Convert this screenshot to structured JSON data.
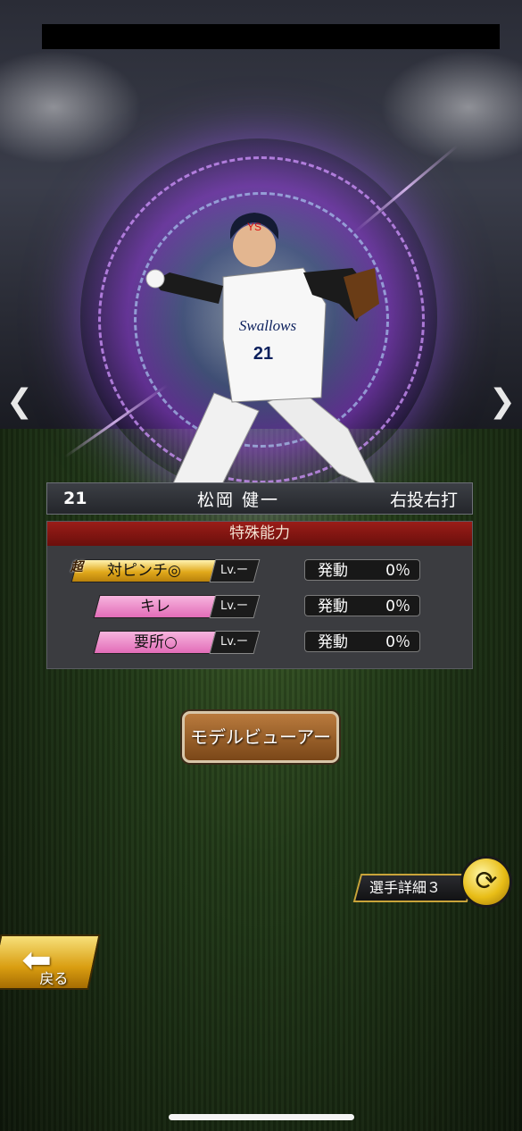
{
  "player": {
    "number": "21",
    "name": "松岡 健一",
    "handedness": "右投右打",
    "jersey_text": "Swallows",
    "jersey_number": "21"
  },
  "abilities": {
    "title": "特殊能力",
    "super_badge": "超",
    "items": [
      {
        "name": "対ピンチ◎",
        "level": "Lv.ー",
        "activation_label": "発動",
        "activation_value": "0％",
        "tier": "gold"
      },
      {
        "name": "キレ",
        "level": "Lv.ー",
        "activation_label": "発動",
        "activation_value": "0％",
        "tier": "pink"
      },
      {
        "name": "要所○",
        "level": "Lv.ー",
        "activation_label": "発動",
        "activation_value": "0％",
        "tier": "pink"
      }
    ]
  },
  "buttons": {
    "model_viewer": "モデルビューアー",
    "player_detail": "選手詳細３",
    "back": "戻る"
  },
  "nav": {
    "prev": "❮",
    "next": "❯"
  },
  "icons": {
    "swap": "swap-arrows-icon",
    "back_arrow": "back-arrow-icon"
  }
}
